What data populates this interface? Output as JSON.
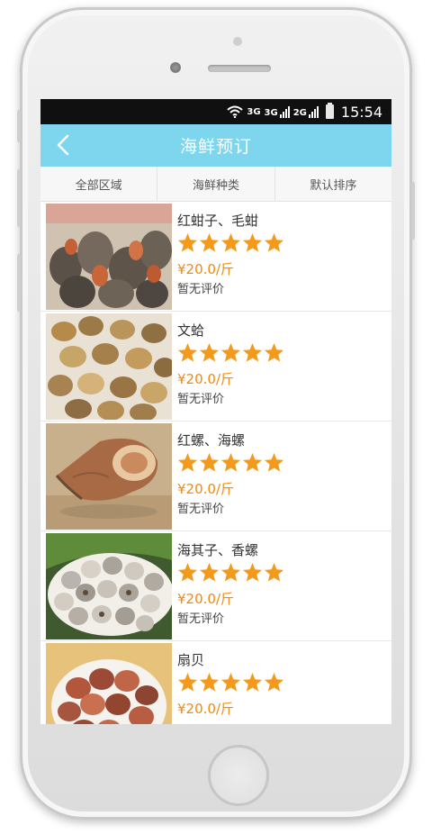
{
  "statusbar": {
    "network1": "3G",
    "network2": "3G",
    "network3": "2G",
    "time": "15:54"
  },
  "header": {
    "title": "海鲜预订"
  },
  "filters": [
    {
      "label": "全部区域"
    },
    {
      "label": "海鲜种类"
    },
    {
      "label": "默认排序"
    }
  ],
  "colors": {
    "accent": "#7dd6ee",
    "price": "#f08a10",
    "star": "#f39a1c"
  },
  "items": [
    {
      "name": "红蚶子、毛蚶",
      "rating": 5,
      "price": "¥20.0/斤",
      "review": "暂无评价"
    },
    {
      "name": "文蛤",
      "rating": 5,
      "price": "¥20.0/斤",
      "review": "暂无评价"
    },
    {
      "name": "红螺、海螺",
      "rating": 5,
      "price": "¥20.0/斤",
      "review": "暂无评价"
    },
    {
      "name": "海其子、香螺",
      "rating": 5,
      "price": "¥20.0/斤",
      "review": "暂无评价"
    },
    {
      "name": "扇贝",
      "rating": 5,
      "price": "¥20.0/斤",
      "review": ""
    }
  ]
}
